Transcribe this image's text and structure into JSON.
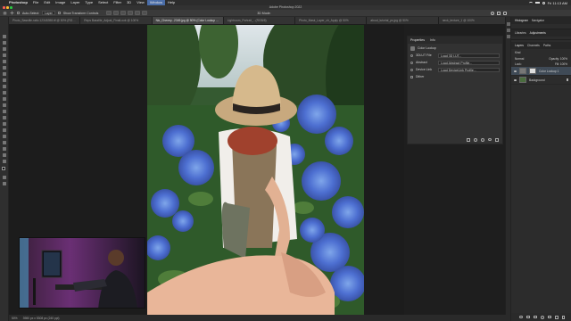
{
  "menubar": {
    "app": "Photoshop",
    "items": [
      "File",
      "Edit",
      "Image",
      "Layer",
      "Type",
      "Select",
      "Filter",
      "3D",
      "View",
      "Window",
      "Help"
    ],
    "clock": "Fri 11:13 AM"
  },
  "window": {
    "title": "Adobe Photoshop 2022"
  },
  "options": {
    "auto_select_label": "Auto-Select:",
    "auto_select_value": "Layer",
    "show_transform_label": "Show Transform Controls",
    "mode_label": "3D Mode:"
  },
  "tabs": [
    {
      "label": "Photo_Bassfile-ratio.12345398.tif @ 50% (RGB/8)",
      "active": false
    },
    {
      "label": "Reps Bassfile_Adjust_FinalLook @ 100%",
      "active": false
    },
    {
      "label": "Nic_Cheney...2349.jpg @ 50% (Color Lookup 1, Layer Mask/8)",
      "active": true
    },
    {
      "label": "Lightroom_Portrait_...(RGB/8)",
      "active": false
    },
    {
      "label": "Photo_Mask_Layer_ch_Apply @ 50%",
      "active": false
    },
    {
      "label": "about_tutorial_ps.jpg @ 50%",
      "active": false
    },
    {
      "label": "neck_texture_1 @ 100%",
      "active": false
    }
  ],
  "properties": {
    "tabs": [
      "Properties",
      "Info"
    ],
    "title": "Color Lookup",
    "rows": [
      {
        "label": "3DLUT File",
        "value": "Load 3D LUT..."
      },
      {
        "label": "Abstract",
        "value": "Load Abstract Profile..."
      },
      {
        "label": "Device Link",
        "value": "Load DeviceLink Profile..."
      }
    ],
    "dither_label": "Dither"
  },
  "right_dock": {
    "top_tabs": [
      "Histogram",
      "Navigator"
    ],
    "mid_tabs": [
      "Libraries",
      "Adjustments"
    ],
    "layer_tabs": [
      "Layers",
      "Channels",
      "Paths"
    ],
    "kind_label": "Kind",
    "mode_label": "Normal",
    "opacity_label": "Opacity: 100%",
    "fill_label": "Fill: 100%",
    "lock_label": "Lock:",
    "layers": [
      {
        "name": "Color Lookup 1",
        "selected": true
      },
      {
        "name": "Background",
        "selected": false
      }
    ]
  },
  "status": {
    "zoom": "50%",
    "doc": "3980 px x 5308 px (240 ppi)"
  }
}
